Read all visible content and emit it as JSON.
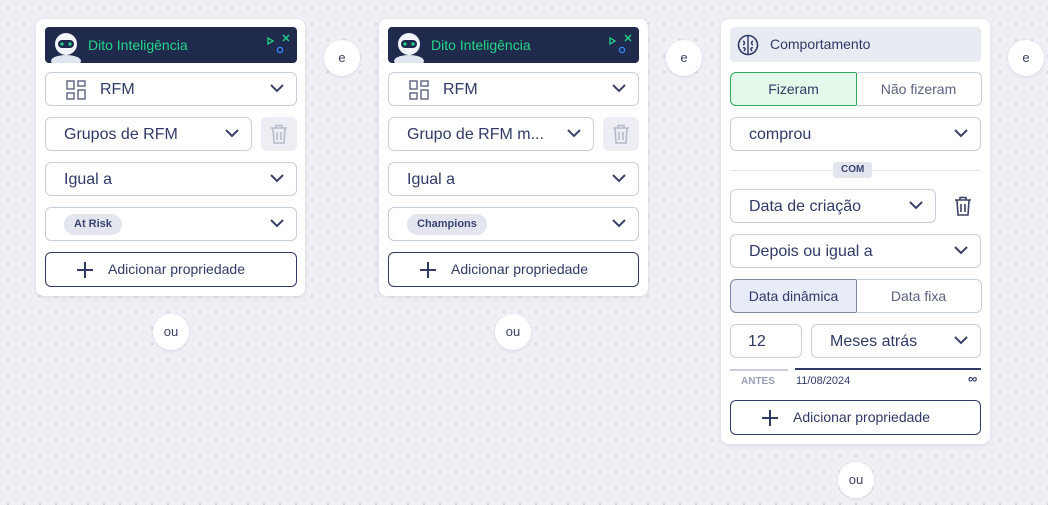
{
  "card1": {
    "banner": "Dito Inteligência",
    "entity": "RFM",
    "property": "Grupos de RFM",
    "operator": "Igual a",
    "value_tag": "At Risk",
    "add_label": "Adicionar propriedade"
  },
  "card2": {
    "banner": "Dito Inteligência",
    "entity": "RFM",
    "property": "Grupo de RFM m...",
    "operator": "Igual a",
    "value_tag": "Champions",
    "add_label": "Adicionar propriedade"
  },
  "card3": {
    "title": "Comportamento",
    "toggle_did": "Fizeram",
    "toggle_did_not": "Não fizeram",
    "action": "comprou",
    "with_tag": "COM",
    "property": "Data de criação",
    "operator": "Depois ou igual a",
    "date_dynamic": "Data dinâmica",
    "date_fixed": "Data fixa",
    "amount": "12",
    "unit": "Meses atrás",
    "before_label": "ANTES",
    "date_value": "11/08/2024",
    "infinity": "∞",
    "add_label": "Adicionar propriedade"
  },
  "connectors": {
    "and": "e",
    "or": "ou"
  },
  "colors": {
    "accent_green": "#22d68a",
    "navy": "#2f3a66",
    "banner_bg": "#1f2a4d",
    "selected_green_bg": "#e5f9ea",
    "selected_blue_bg": "#e8ecf7"
  }
}
